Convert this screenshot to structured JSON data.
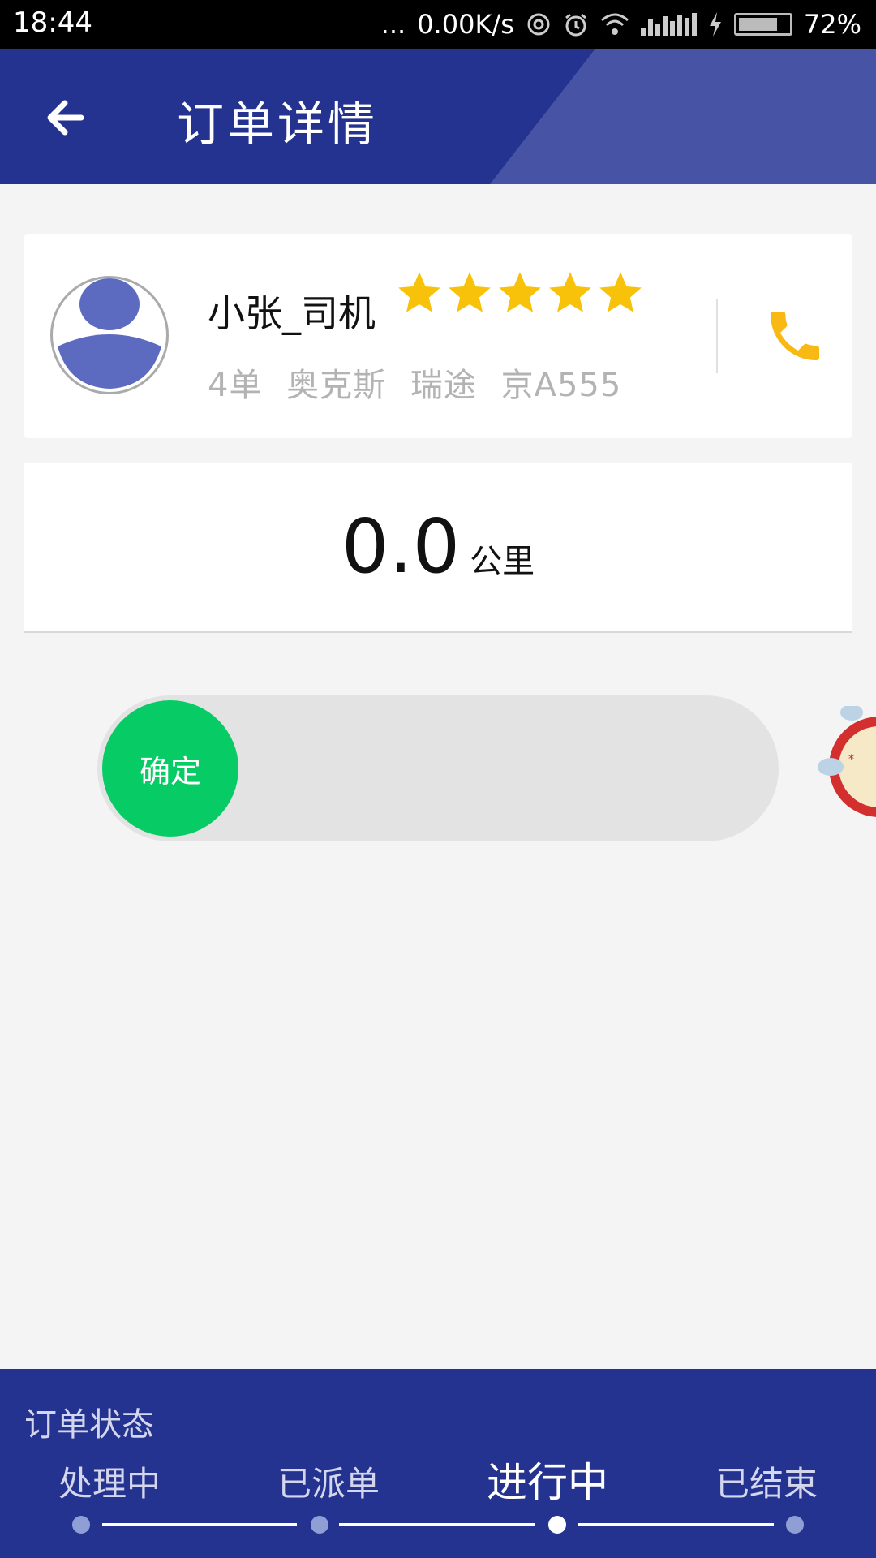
{
  "status_bar": {
    "time": "18:44",
    "dots": "...",
    "net_speed": "0.00K/s",
    "battery": "72%"
  },
  "header": {
    "title": "订单详情",
    "back_icon": "arrow-left-icon"
  },
  "driver": {
    "name": "小张_司机",
    "rating": 5,
    "rating_max": 5,
    "orders": "4单",
    "brand": "奥克斯",
    "model": "瑞途",
    "plate": "京A555",
    "phone_icon": "phone-icon"
  },
  "distance": {
    "value": "0.0",
    "unit": "公里"
  },
  "slider": {
    "knob_label": "确定"
  },
  "order_status": {
    "label": "订单状态",
    "steps": [
      "处理中",
      "已派单",
      "进行中",
      "已结束"
    ],
    "active_index": 2
  },
  "colors": {
    "header_bg": "#24338f",
    "header_deco": "#4754a5",
    "star": "#f9c20a",
    "phone": "#f9b915",
    "confirm_green": "#07cb64",
    "avatar": "#5c6bc0"
  }
}
